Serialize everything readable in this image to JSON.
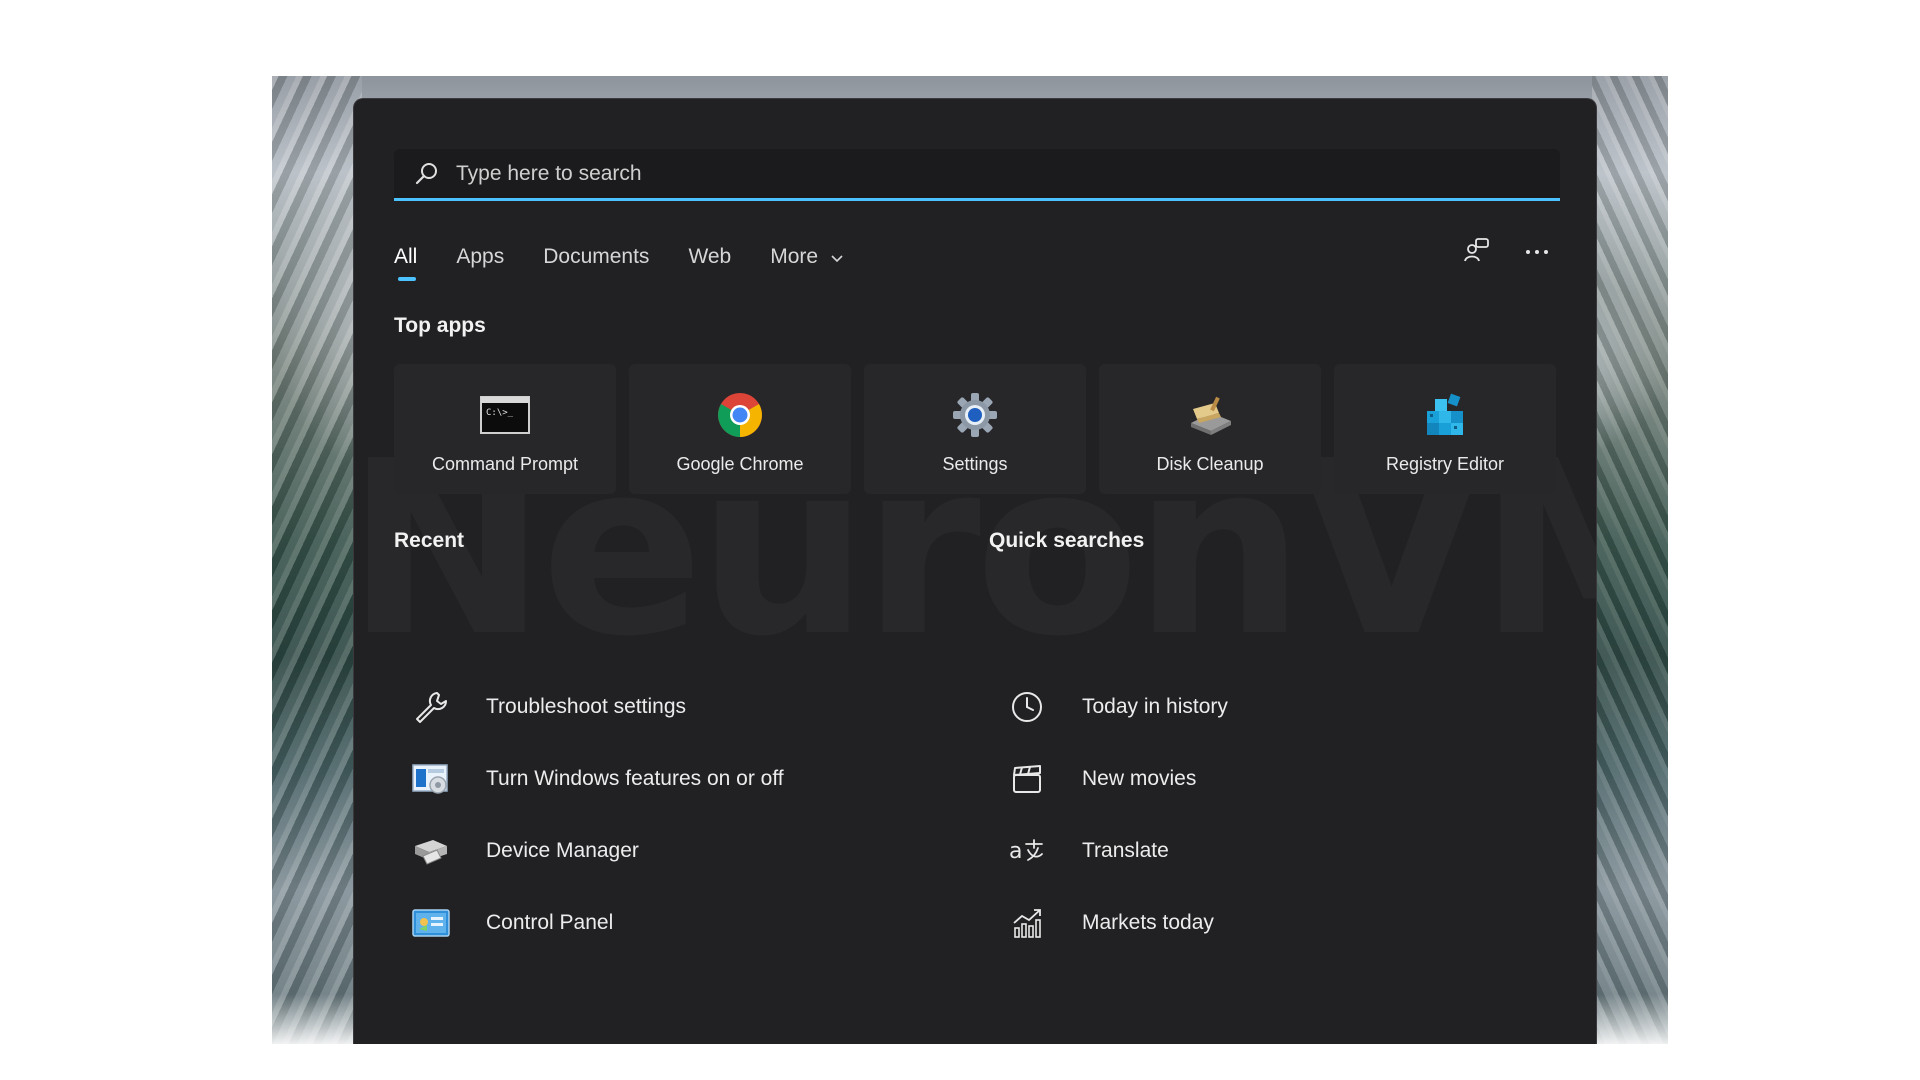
{
  "search": {
    "placeholder": "Type here to search"
  },
  "tabs": [
    {
      "label": "All"
    },
    {
      "label": "Apps"
    },
    {
      "label": "Documents"
    },
    {
      "label": "Web"
    },
    {
      "label": "More"
    }
  ],
  "watermark": "NeuronVM",
  "top_apps": {
    "title": "Top apps",
    "items": [
      {
        "label": "Command Prompt",
        "icon": "command-prompt-icon"
      },
      {
        "label": "Google Chrome",
        "icon": "chrome-icon"
      },
      {
        "label": "Settings",
        "icon": "gear-icon"
      },
      {
        "label": "Disk Cleanup",
        "icon": "disk-cleanup-icon"
      },
      {
        "label": "Registry Editor",
        "icon": "registry-editor-icon"
      }
    ]
  },
  "recent": {
    "title": "Recent",
    "items": [
      {
        "label": "Troubleshoot settings",
        "icon": "wrench-icon"
      },
      {
        "label": "Turn Windows features on or off",
        "icon": "windows-features-icon"
      },
      {
        "label": "Device Manager",
        "icon": "device-manager-icon"
      },
      {
        "label": "Control Panel",
        "icon": "control-panel-icon"
      }
    ]
  },
  "quick_searches": {
    "title": "Quick searches",
    "items": [
      {
        "label": "Today in history",
        "icon": "clock-icon"
      },
      {
        "label": "New movies",
        "icon": "clapperboard-icon"
      },
      {
        "label": "Translate",
        "icon": "translate-icon"
      },
      {
        "label": "Markets today",
        "icon": "chart-icon"
      }
    ]
  },
  "colors": {
    "accent": "#4cc2ff",
    "panel_bg": "#212124"
  }
}
